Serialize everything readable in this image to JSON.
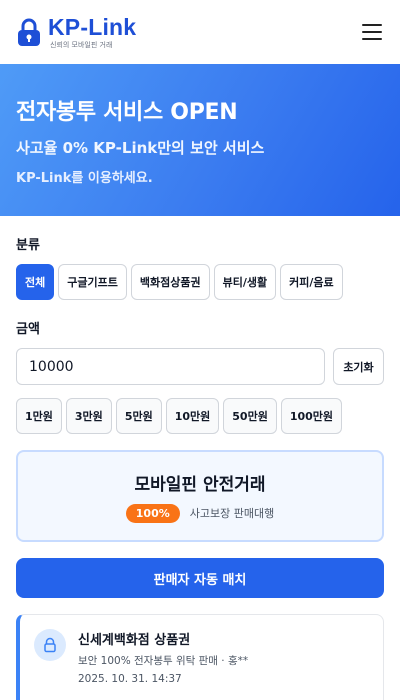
{
  "header": {
    "logo_name": "KP-Link",
    "logo_tagline": "신뢰의 모바일핀 거래",
    "menu_icon": "hamburger-icon"
  },
  "hero": {
    "title": "전자봉투 서비스 OPEN",
    "subtitle": "사고율 0% KP-Link만의 보안 서비스",
    "subtitle2": "KP-Link를 이용하세요."
  },
  "category": {
    "label": "분류",
    "items": [
      "전체",
      "구글기프트",
      "백화점상품권",
      "뷰티/생활",
      "커피/음료"
    ],
    "selected": "전체"
  },
  "amount": {
    "label": "금액",
    "value": "10000",
    "reset_label": "초기화",
    "quick": [
      "1만원",
      "3만원",
      "5만원",
      "10만원",
      "50만원",
      "100만원"
    ]
  },
  "safe_trade": {
    "title": "모바일핀 안전거래",
    "badge": "100%",
    "text": "사고보장 판매대행"
  },
  "match_button": "판매자 자동 매치",
  "listing": {
    "title": "신세계백화점 상품권",
    "desc": "보안 100% 전자봉투 위탁 판매 · 홍**",
    "date": "2025. 10. 31. 14:37",
    "icon": "lock-icon"
  },
  "colors": {
    "brand": "#1e4fd6",
    "primary": "#2563eb",
    "badge": "#f97316"
  }
}
